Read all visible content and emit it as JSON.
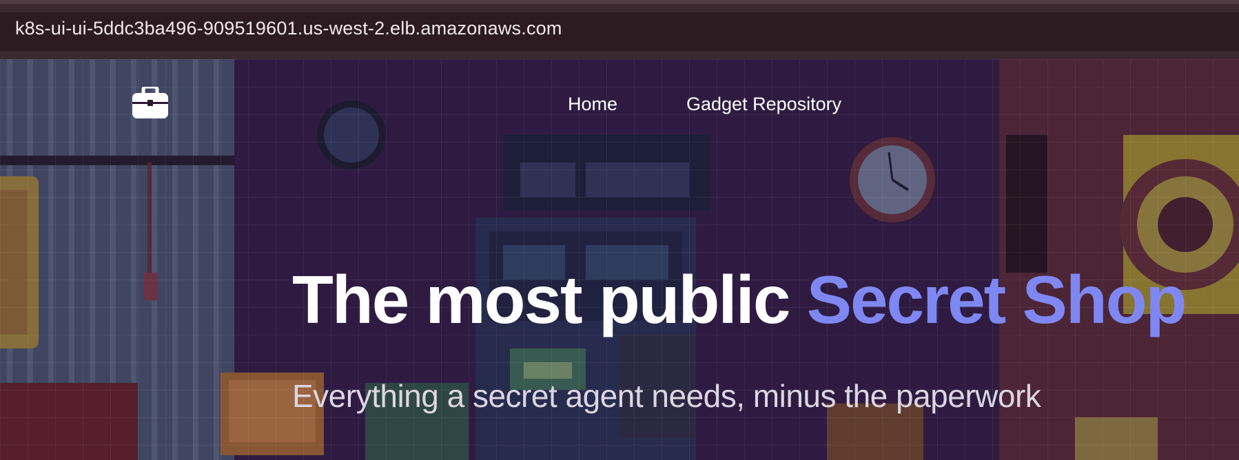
{
  "browser": {
    "url": "k8s-ui-ui-5ddc3ba496-909519601.us-west-2.elb.amazonaws.com"
  },
  "nav": {
    "logo_icon": "briefcase-icon",
    "links": [
      {
        "label": "Home"
      },
      {
        "label": "Gadget Repository"
      }
    ]
  },
  "hero": {
    "headline_main": "The most public ",
    "headline_accent": "Secret Shop",
    "subheadline": "Everything a secret agent needs, minus the paperwork",
    "accent_color": "#7f88f2"
  }
}
